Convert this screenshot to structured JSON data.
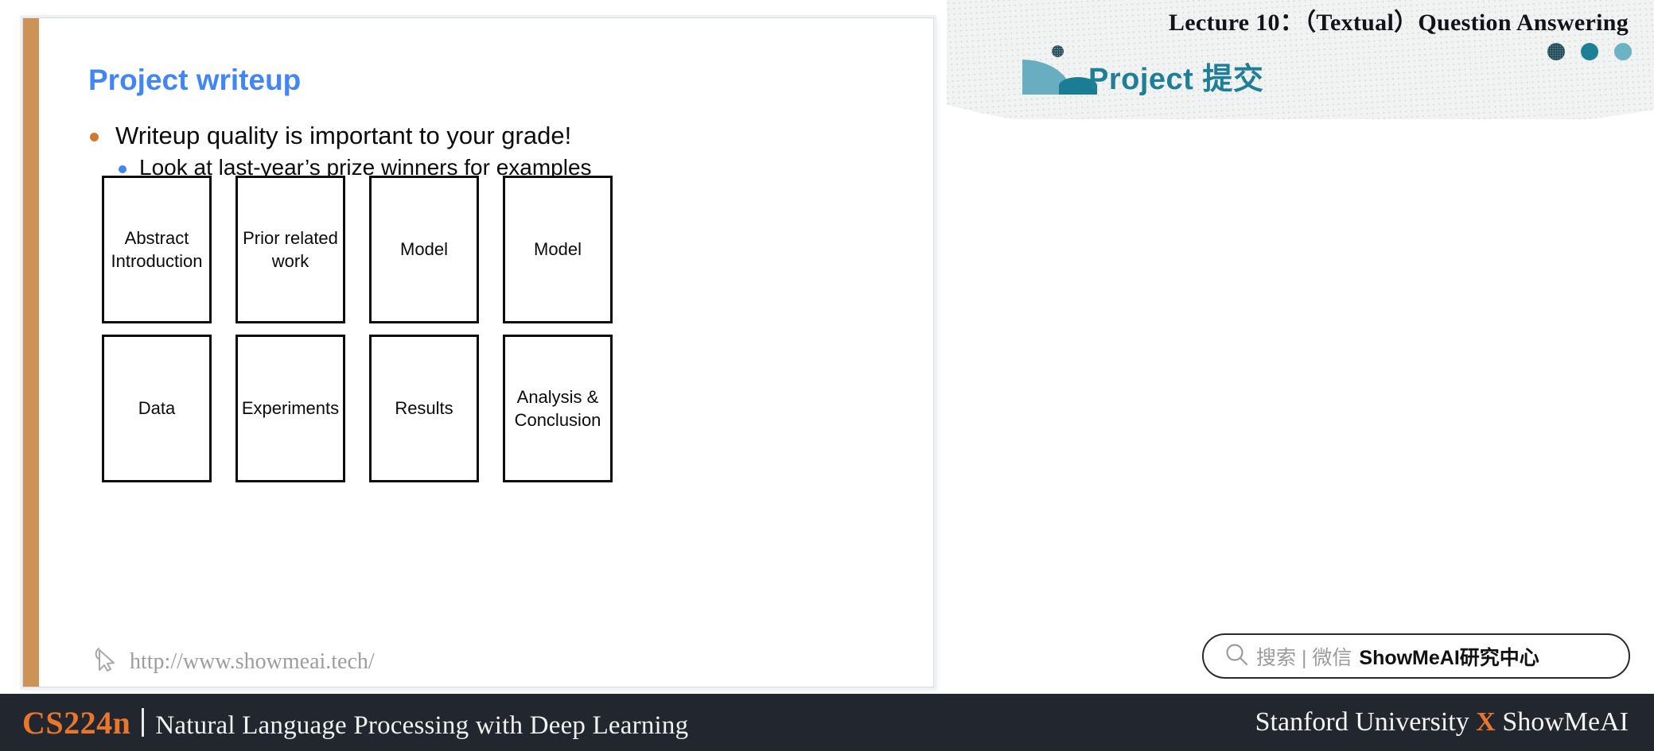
{
  "header": {
    "lecture_title": "Lecture 10：（Textual）Question Answering",
    "brand_title": "Project 提交",
    "dots": [
      "dot-dark",
      "dot-teal",
      "dot-light-teal"
    ],
    "colors": {
      "dot_dark": "#2d4351",
      "dot_teal": "#1e7f96",
      "dot_light_teal": "#6cb3c4",
      "brand_text": "#1e7f96",
      "band": "#f1f2f2"
    }
  },
  "slide": {
    "title": "Project writeup",
    "title_color": "#4285f4",
    "accent_bar_color": "#cd9255",
    "bullets": [
      {
        "text": "Writeup quality is important to your grade!",
        "dot_color": "#d2772b",
        "level": 1
      },
      {
        "text": "Look at last-year’s prize winners for examples",
        "dot_color": "#4285f4",
        "level": 2
      }
    ],
    "boxes": {
      "row1": [
        {
          "lines": [
            "Abstract",
            "Introduction"
          ]
        },
        {
          "lines": [
            "Prior related",
            "work"
          ]
        },
        {
          "lines": [
            "Model"
          ]
        },
        {
          "lines": [
            "Model"
          ]
        }
      ],
      "row2": [
        {
          "lines": [
            "Data"
          ]
        },
        {
          "lines": [
            "Experiments"
          ]
        },
        {
          "lines": [
            "Results"
          ]
        },
        {
          "lines": [
            "Analysis &",
            "Conclusion"
          ]
        }
      ]
    },
    "watermark": "http://www.showmeai.tech/"
  },
  "search": {
    "placeholder": "搜索 | 微信",
    "brand": "ShowMeAI研究中心"
  },
  "footer": {
    "course_code": "CS224n",
    "course_name": "Natural Language Processing with Deep Learning",
    "affiliation_left": "Stanford University",
    "affiliation_x": "X",
    "affiliation_right": "ShowMeAI",
    "background": "#22262e",
    "accent": "#e8762c"
  }
}
